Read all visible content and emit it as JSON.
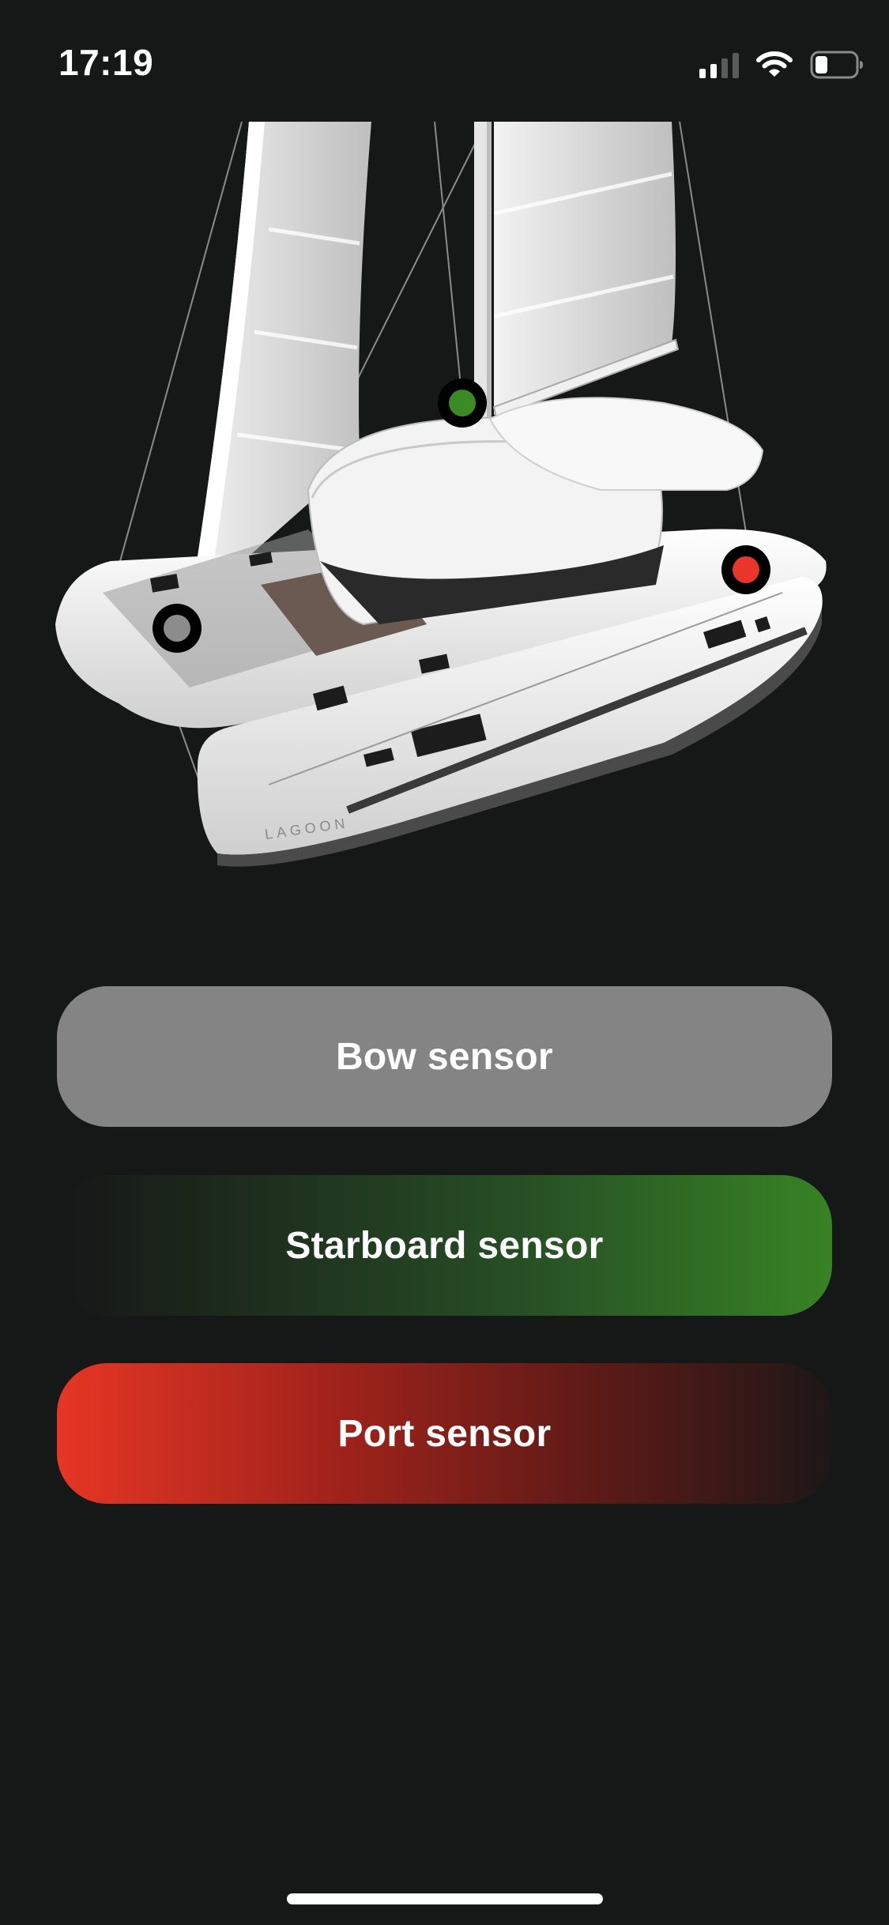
{
  "status_bar": {
    "time": "17:19",
    "icons": [
      "cellular-signal-icon",
      "wifi-icon",
      "battery-icon"
    ],
    "cellular_bars_active": 2,
    "cellular_bars_total": 4,
    "battery_level": 0.25
  },
  "boat": {
    "image": "catamaran-sailboat-image",
    "hull_lettering": "LAGOON"
  },
  "markers": [
    {
      "name": "bow-sensor-marker",
      "color": "#8c8c8c"
    },
    {
      "name": "starboard-sensor-marker",
      "color": "#3a8a25"
    },
    {
      "name": "port-sensor-marker",
      "color": "#e8362a"
    }
  ],
  "buttons": {
    "bow_label": "Bow sensor",
    "starboard_label": "Starboard sensor",
    "port_label": "Port sensor"
  },
  "colors": {
    "background": "#161717",
    "bow": "#848484",
    "starboard": "#378324",
    "port": "#e63624"
  }
}
